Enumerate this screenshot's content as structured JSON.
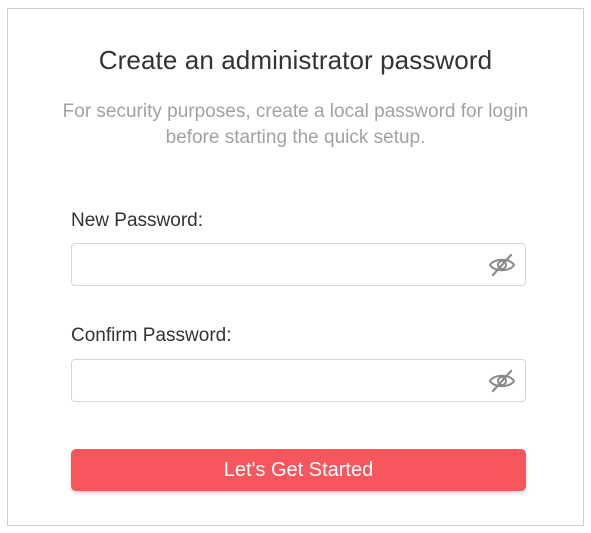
{
  "header": {
    "title": "Create an administrator password",
    "subtitle": "For security purposes, create a local password for login before starting the quick setup."
  },
  "form": {
    "new_password": {
      "label": "New Password:",
      "value": "",
      "placeholder": "",
      "toggle_icon": "eye-slash-icon"
    },
    "confirm_password": {
      "label": "Confirm Password:",
      "value": "",
      "placeholder": "",
      "toggle_icon": "eye-slash-icon"
    },
    "submit_label": "Let's Get Started"
  },
  "colors": {
    "accent": "#f8565d",
    "title_text": "#333333",
    "muted_text": "#a2a2a2",
    "icon": "#8a8a8a"
  }
}
